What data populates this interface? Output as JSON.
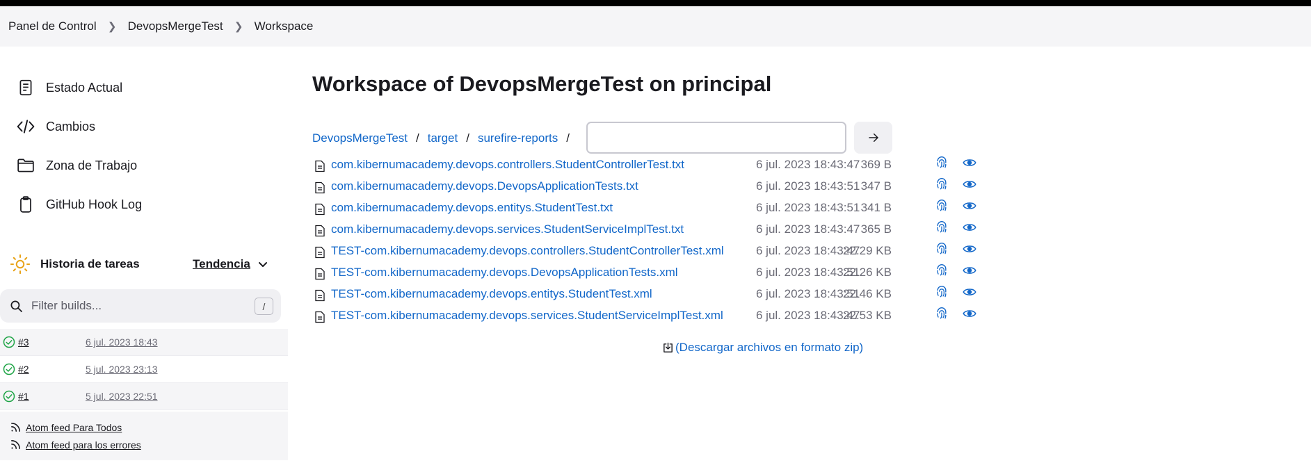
{
  "breadcrumb": {
    "items": [
      "Panel de Control",
      "DevopsMergeTest",
      "Workspace"
    ]
  },
  "sidebar": {
    "items": [
      {
        "label": "Estado Actual",
        "icon": "document-icon"
      },
      {
        "label": "Cambios",
        "icon": "code-icon"
      },
      {
        "label": "Zona de Trabajo",
        "icon": "folder-icon"
      },
      {
        "label": "GitHub Hook Log",
        "icon": "clipboard-icon"
      }
    ]
  },
  "history": {
    "title": "Historia de tareas",
    "trend_label": "Tendencia",
    "filter_placeholder": "Filter builds...",
    "filter_shortcut": "/",
    "builds": [
      {
        "number": "#3",
        "date": "6 jul. 2023 18:43",
        "status": "success"
      },
      {
        "number": "#2",
        "date": "5 jul. 2023 23:13",
        "status": "success"
      },
      {
        "number": "#1",
        "date": "5 jul. 2023 22:51",
        "status": "success"
      }
    ],
    "feeds": [
      "Atom feed Para Todos",
      "Atom feed para los errores"
    ]
  },
  "main": {
    "title": "Workspace of DevopsMergeTest on principal",
    "path": [
      "DevopsMergeTest",
      "target",
      "surefire-reports"
    ],
    "path_separator": "/",
    "path_input_value": "",
    "files": [
      {
        "name": "com.kibernumacademy.devops.controllers.StudentControllerTest.txt",
        "date": "6 jul. 2023 18:43:47",
        "size": "369 B"
      },
      {
        "name": "com.kibernumacademy.devops.DevopsApplicationTests.txt",
        "date": "6 jul. 2023 18:43:51",
        "size": "347 B"
      },
      {
        "name": "com.kibernumacademy.devops.entitys.StudentTest.txt",
        "date": "6 jul. 2023 18:43:51",
        "size": "341 B"
      },
      {
        "name": "com.kibernumacademy.devops.services.StudentServiceImplTest.txt",
        "date": "6 jul. 2023 18:43:47",
        "size": "365 B"
      },
      {
        "name": "TEST-com.kibernumacademy.devops.controllers.StudentControllerTest.xml",
        "date": "6 jul. 2023 18:43:47",
        "size": "22.29 KB"
      },
      {
        "name": "TEST-com.kibernumacademy.devops.DevopsApplicationTests.xml",
        "date": "6 jul. 2023 18:43:51",
        "size": "22.26 KB"
      },
      {
        "name": "TEST-com.kibernumacademy.devops.entitys.StudentTest.xml",
        "date": "6 jul. 2023 18:43:51",
        "size": "22.46 KB"
      },
      {
        "name": "TEST-com.kibernumacademy.devops.services.StudentServiceImplTest.xml",
        "date": "6 jul. 2023 18:43:47",
        "size": "22.53 KB"
      }
    ],
    "zip_label": "(Descargar archivos en formato zip)"
  },
  "colors": {
    "link": "#1267c9",
    "success": "#1ea446",
    "muted": "#6b6b76"
  }
}
